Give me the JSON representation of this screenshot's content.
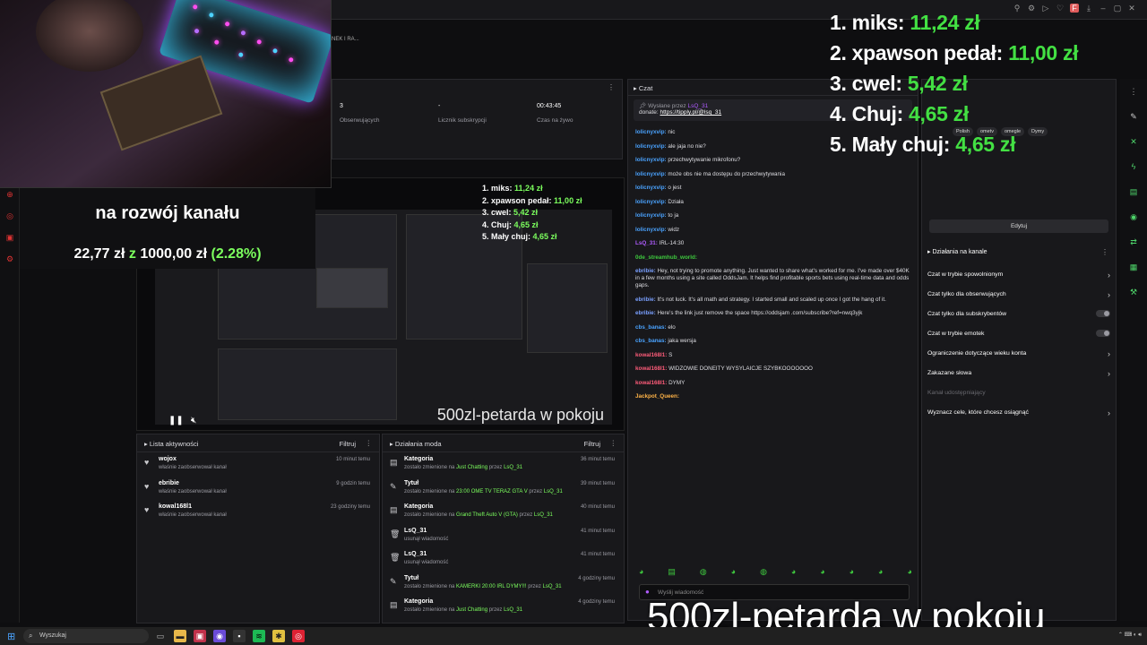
{
  "browser": {
    "tab_text": "NEK I RA..."
  },
  "goal": {
    "title": "na rozwój kanału",
    "current": "22,77 zł",
    "separator": "z",
    "target": "1000,00 zł",
    "percent": "(2.28%)"
  },
  "stats": [
    {
      "value": "3",
      "label": "Obserwujących"
    },
    {
      "value": "-",
      "label": "Licznik subskrypcji"
    },
    {
      "value": "00:43:45",
      "label": "Czas na żywo"
    }
  ],
  "ranking": [
    {
      "name": "1. miks:",
      "amount": "11,24 zł"
    },
    {
      "name": "2. xpawson pedał:",
      "amount": "11,00 zł"
    },
    {
      "name": "3. cwel:",
      "amount": "5,42 zł"
    },
    {
      "name": "4. Chuj:",
      "amount": "4,65 zł"
    },
    {
      "name": "5. Mały chuj:",
      "amount": "4,65 zł"
    }
  ],
  "video": {
    "caption": "500zl-petarda w pokoju",
    "play_icon": "pause-icon",
    "mute_icon": "mute-icon"
  },
  "activity": {
    "title": "Lista aktywności",
    "filter": "Filtruj",
    "items": [
      {
        "name": "wojox",
        "desc": "właśnie zaobserwował kanał",
        "time": "10 minut temu"
      },
      {
        "name": "ebribie",
        "desc": "właśnie zaobserwował kanał",
        "time": "9 godzin temu"
      },
      {
        "name": "kowal168l1",
        "desc": "właśnie zaobserwował kanał",
        "time": "23 godziny temu"
      }
    ]
  },
  "mod": {
    "title": "Działania moda",
    "filter": "Filtruj",
    "items": [
      {
        "name": "Kategoria",
        "pre": "zostało zmienione na",
        "hl": "Just Chatting",
        "mid": "przez",
        "by": "LsQ_31",
        "time": "36 minut temu"
      },
      {
        "name": "Tytuł",
        "pre": "zostało zmienione na",
        "hl": "23:00 OME TV TERAZ GTA V",
        "mid": "przez",
        "by": "LsQ_31",
        "time": "39 minut temu"
      },
      {
        "name": "Kategoria",
        "pre": "zostało zmienione na",
        "hl": "Grand Theft Auto V (GTA)",
        "mid": "przez",
        "by": "LsQ_31",
        "time": "40 minut temu"
      },
      {
        "name": "LsQ_31",
        "pre": "usunął wiadomość",
        "hl": "",
        "mid": "",
        "by": "",
        "time": "41 minut temu"
      },
      {
        "name": "LsQ_31",
        "pre": "usunął wiadomość",
        "hl": "",
        "mid": "",
        "by": "",
        "time": "41 minut temu"
      },
      {
        "name": "Tytuł",
        "pre": "zostało zmienione na",
        "hl": "KAMERKI 20:00 IRL DYMY!!!",
        "mid": "przez",
        "by": "LsQ_31",
        "time": "4 godziny temu"
      },
      {
        "name": "Kategoria",
        "pre": "zostało zmienione na",
        "hl": "Just Chatting",
        "mid": "przez",
        "by": "LsQ_31",
        "time": "4 godziny temu"
      }
    ]
  },
  "chat": {
    "title": "Czat",
    "pinned_by": "Wysłane przez",
    "pinned_user": "LsQ_31",
    "pinned_text": "donate:",
    "pinned_link": "https://tipply.pl/@lsq_31",
    "input_placeholder": "Wyślij wiadomość",
    "messages": [
      {
        "user": "lolicnyxvip:",
        "text": "nic",
        "color": "#4aa3ff"
      },
      {
        "user": "lolicnyxvip:",
        "text": "ale jaja no nie?",
        "color": "#4aa3ff"
      },
      {
        "user": "lolicnyxvip:",
        "text": "przechwytywanie mikrofonu?",
        "color": "#4aa3ff"
      },
      {
        "user": "lolicnyxvip:",
        "text": "może obs nie ma dostępu do przechwytywania",
        "color": "#4aa3ff"
      },
      {
        "user": "lolicnyxvip:",
        "text": "o jest",
        "color": "#4aa3ff"
      },
      {
        "user": "lolicnyxvip:",
        "text": "Działa",
        "color": "#4aa3ff"
      },
      {
        "user": "lolicnyxvip:",
        "text": "to ja",
        "color": "#4aa3ff"
      },
      {
        "user": "lolicnyxvip:",
        "text": "widz",
        "color": "#4aa3ff"
      },
      {
        "user": "LsQ_31:",
        "text": "IRL-14:30",
        "color": "#b05cff"
      },
      {
        "user": "0de_streamhub_world:",
        "text": "",
        "color": "#3ec93e"
      },
      {
        "user": "ebribie:",
        "text": "Hey, not trying to promote anything. Just wanted to share what's worked for me. I've made over $40K in a few months using a site called OddsJam. It helps find profitable sports bets using real-time data and odds gaps.",
        "color": "#7aa0ff"
      },
      {
        "user": "ebribie:",
        "text": "It's not luck. It's all math and strategy. I started small and scaled up once I got the hang of it.",
        "color": "#7aa0ff"
      },
      {
        "user": "ebribie:",
        "text": "Here's the link just remove the space https://oddsjam .com/subscribe?ref=nwq3yjk",
        "color": "#7aa0ff"
      },
      {
        "user": "cbs_banas:",
        "text": "elo",
        "color": "#4aa3ff"
      },
      {
        "user": "cbs_banas:",
        "text": "jaka wersja",
        "color": "#4aa3ff"
      },
      {
        "user": "kowal168l1:",
        "text": "S",
        "color": "#ff5c7a"
      },
      {
        "user": "kowal168l1:",
        "text": "WIDZOWIE DONEITY WYSYLAICJE SZYBKOOOOOOO",
        "color": "#ff5c7a"
      },
      {
        "user": "kowal168l1:",
        "text": "DYMY",
        "color": "#ff5c7a"
      },
      {
        "user": "Jackpot_Queen:",
        "text": "",
        "color": "#ffb347"
      }
    ]
  },
  "right": {
    "tags": [
      "Polish",
      "ometv",
      "omegle",
      "Dymy"
    ],
    "edit": "Edytuj",
    "channel_actions": "Działania na kanale",
    "settings": [
      {
        "label": "Czat w trybie spowolnionym",
        "kind": "arrow"
      },
      {
        "label": "Czat tylko dla obserwujących",
        "kind": "arrow"
      },
      {
        "label": "Czat tylko dla subskrybentów",
        "kind": "toggle"
      },
      {
        "label": "Czat w trybie emotek",
        "kind": "toggle"
      },
      {
        "label": "Ograniczenie dotyczące wieku konta",
        "kind": "arrow"
      },
      {
        "label": "Zakazane słowa",
        "kind": "arrow"
      },
      {
        "label": "Kanał udostępniający",
        "kind": "dim"
      },
      {
        "label": "Wyznacz cele, które chcesz osiągnąć",
        "kind": "arrow"
      }
    ]
  },
  "caption": "500zl-petarda w pokoju",
  "taskbar": {
    "search": "Wyszukaj"
  }
}
